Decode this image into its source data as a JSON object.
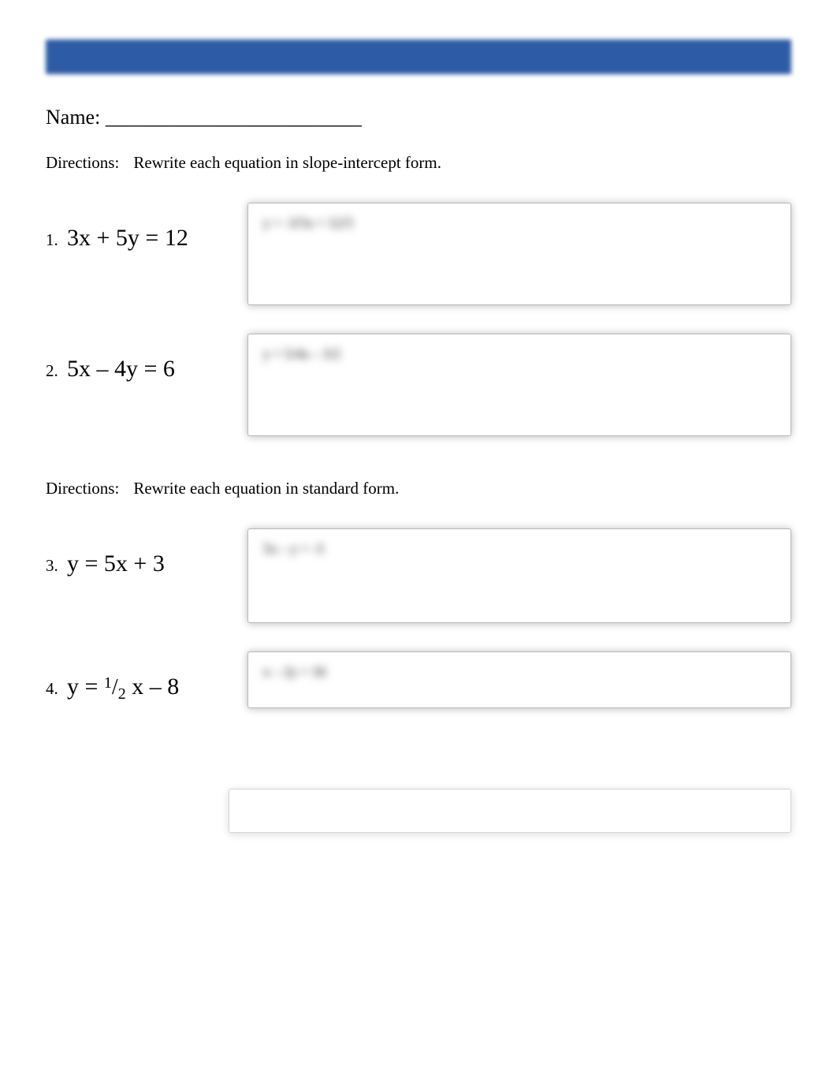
{
  "name_label": "Name:",
  "name_blank": "_________________________",
  "sections": [
    {
      "dir_label": "Directions:",
      "dir_text": "Rewrite each equation in slope-intercept form.",
      "problems": [
        {
          "num": "1.",
          "equation": "3x + 5y = 12",
          "answer_hint": "y = -3/5x + 12/5"
        },
        {
          "num": "2.",
          "equation": "5x – 4y = 6",
          "answer_hint": "y = 5/4x – 3/2"
        }
      ]
    },
    {
      "dir_label": "Directions:",
      "dir_text": "Rewrite each equation in standard form.",
      "problems": [
        {
          "num": "3.",
          "equation": "y = 5x + 3",
          "answer_hint": "5x – y = -3"
        },
        {
          "num": "4.",
          "equation_prefix": "y = ",
          "frac_num": "1",
          "frac_den": "2",
          "equation_suffix": " x – 8",
          "answer_hint": "x – 2y = 16"
        }
      ]
    }
  ]
}
